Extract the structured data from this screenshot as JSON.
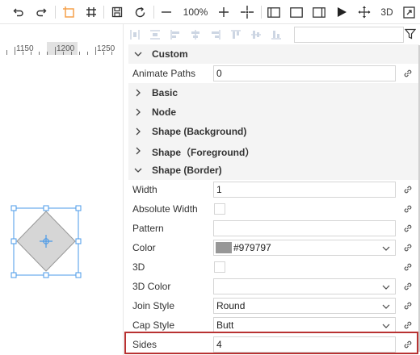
{
  "toolbar": {
    "zoom": "100%",
    "three_d": "3D",
    "buttons": [
      "undo-icon",
      "redo-icon",
      "select-frame-icon",
      "grid-icon",
      "save-icon",
      "reset-icon",
      "zoom-out-icon",
      "zoom-in-icon",
      "center-icon",
      "view-left-icon",
      "view-full-icon",
      "view-right-icon",
      "play-icon",
      "move-icon",
      "3d-toggle",
      "fullscreen-icon"
    ]
  },
  "ruler": {
    "labels": [
      "1150",
      "1200",
      "1250"
    ]
  },
  "panel": {
    "filter_placeholder": "",
    "groups": {
      "custom": "Custom",
      "basic": "Basic",
      "node": "Node",
      "shape_background": "Shape (Background)",
      "shape_foreground": "Shape（Foreground）",
      "shape_border": "Shape (Border)"
    },
    "props": {
      "animate_paths": {
        "label": "Animate Paths",
        "value": "0"
      },
      "width": {
        "label": "Width",
        "value": "1"
      },
      "absolute_width": {
        "label": "Absolute Width"
      },
      "pattern": {
        "label": "Pattern",
        "value": ""
      },
      "color": {
        "label": "Color",
        "value": "#979797"
      },
      "three_d": {
        "label": "3D"
      },
      "three_d_color": {
        "label": "3D Color",
        "value": ""
      },
      "join_style": {
        "label": "Join Style",
        "value": "Round"
      },
      "cap_style": {
        "label": "Cap Style",
        "value": "Butt"
      },
      "sides": {
        "label": "Sides",
        "value": "4"
      }
    }
  },
  "colors": {
    "accent_orange": "#f5a04a",
    "selection_blue": "#4a9ae8",
    "shape_fill": "#d6d6d6",
    "border_swatch": "#979797",
    "highlight_red": "#b83232"
  }
}
